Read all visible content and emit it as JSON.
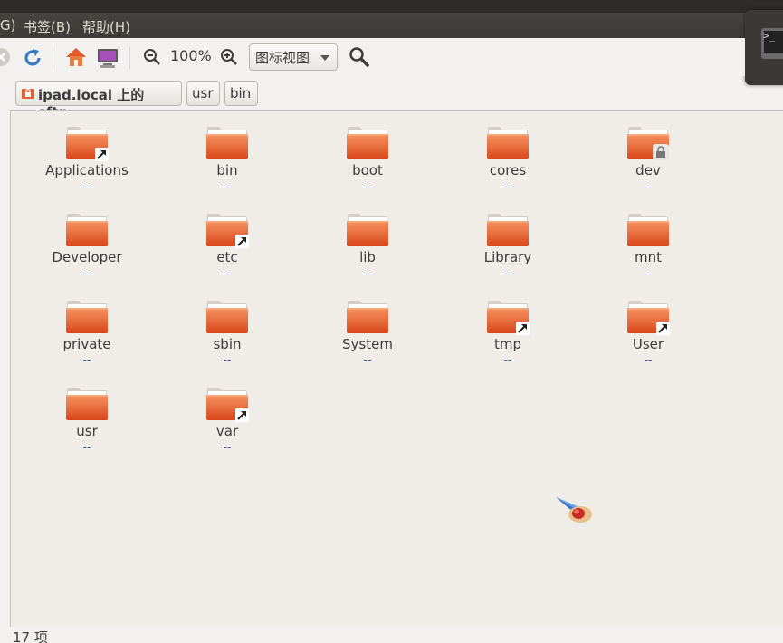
{
  "menubar": {
    "items": [
      {
        "label": "G)"
      },
      {
        "label": "书签(B)"
      },
      {
        "label": "帮助(H)"
      }
    ]
  },
  "toolbar": {
    "zoom_level": "100%",
    "view_mode": "图标视图"
  },
  "pathbar": {
    "crumbs": [
      {
        "label": "ipad.local 上的 sftp"
      },
      {
        "label": "usr"
      },
      {
        "label": "bin"
      }
    ]
  },
  "files": [
    {
      "name": "Applications",
      "size": "--",
      "badge": "link"
    },
    {
      "name": "bin",
      "size": "--",
      "badge": "none"
    },
    {
      "name": "boot",
      "size": "--",
      "badge": "none"
    },
    {
      "name": "cores",
      "size": "--",
      "badge": "none"
    },
    {
      "name": "dev",
      "size": "--",
      "badge": "lock"
    },
    {
      "name": "Developer",
      "size": "--",
      "badge": "none"
    },
    {
      "name": "etc",
      "size": "--",
      "badge": "link"
    },
    {
      "name": "lib",
      "size": "--",
      "badge": "none"
    },
    {
      "name": "Library",
      "size": "--",
      "badge": "none"
    },
    {
      "name": "mnt",
      "size": "--",
      "badge": "none"
    },
    {
      "name": "private",
      "size": "--",
      "badge": "none"
    },
    {
      "name": "sbin",
      "size": "--",
      "badge": "none"
    },
    {
      "name": "System",
      "size": "--",
      "badge": "none"
    },
    {
      "name": "tmp",
      "size": "--",
      "badge": "link"
    },
    {
      "name": "User",
      "size": "--",
      "badge": "link"
    },
    {
      "name": "usr",
      "size": "--",
      "badge": "none"
    },
    {
      "name": "var",
      "size": "--",
      "badge": "link"
    }
  ],
  "status": {
    "text": "17 项"
  },
  "colors": {
    "folder_top": "#f58a55",
    "folder_bottom": "#d9481c",
    "menubar": "#3c3b37",
    "background": "#f0ede8"
  }
}
